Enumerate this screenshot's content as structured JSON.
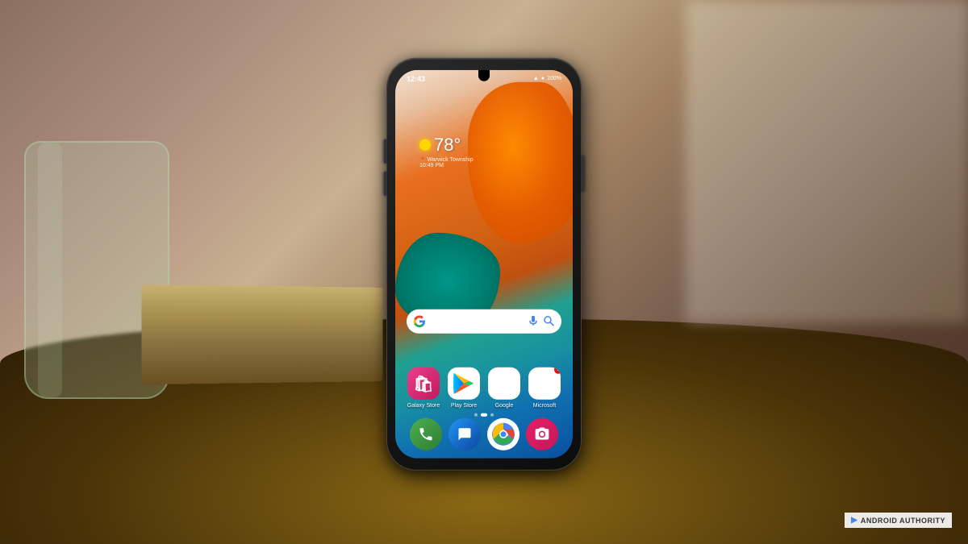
{
  "scene": {
    "background_desc": "Warm wooden table with Samsung phone"
  },
  "phone": {
    "status_bar": {
      "time": "12:43",
      "battery": "100%",
      "signal": "▲▼",
      "wifi": "WiFi"
    },
    "weather": {
      "temperature": "78°",
      "location": "Warwick Township",
      "time": "10:49 PM"
    },
    "search_bar": {
      "placeholder": "Search"
    },
    "apps": [
      {
        "id": "galaxy-store",
        "label": "Galaxy Store",
        "type": "galaxy"
      },
      {
        "id": "play-store",
        "label": "Play Store",
        "type": "play"
      },
      {
        "id": "google",
        "label": "Google",
        "type": "google"
      },
      {
        "id": "microsoft",
        "label": "Microsoft",
        "type": "microsoft"
      }
    ],
    "dock": [
      {
        "id": "phone",
        "label": "Phone",
        "type": "phone"
      },
      {
        "id": "messages",
        "label": "Messages",
        "type": "messages"
      },
      {
        "id": "chrome",
        "label": "Chrome",
        "type": "chrome"
      },
      {
        "id": "camera",
        "label": "Camera",
        "type": "camera"
      }
    ]
  },
  "watermark": {
    "icon": "▶",
    "text": "ANDROID AUTHORITY"
  }
}
